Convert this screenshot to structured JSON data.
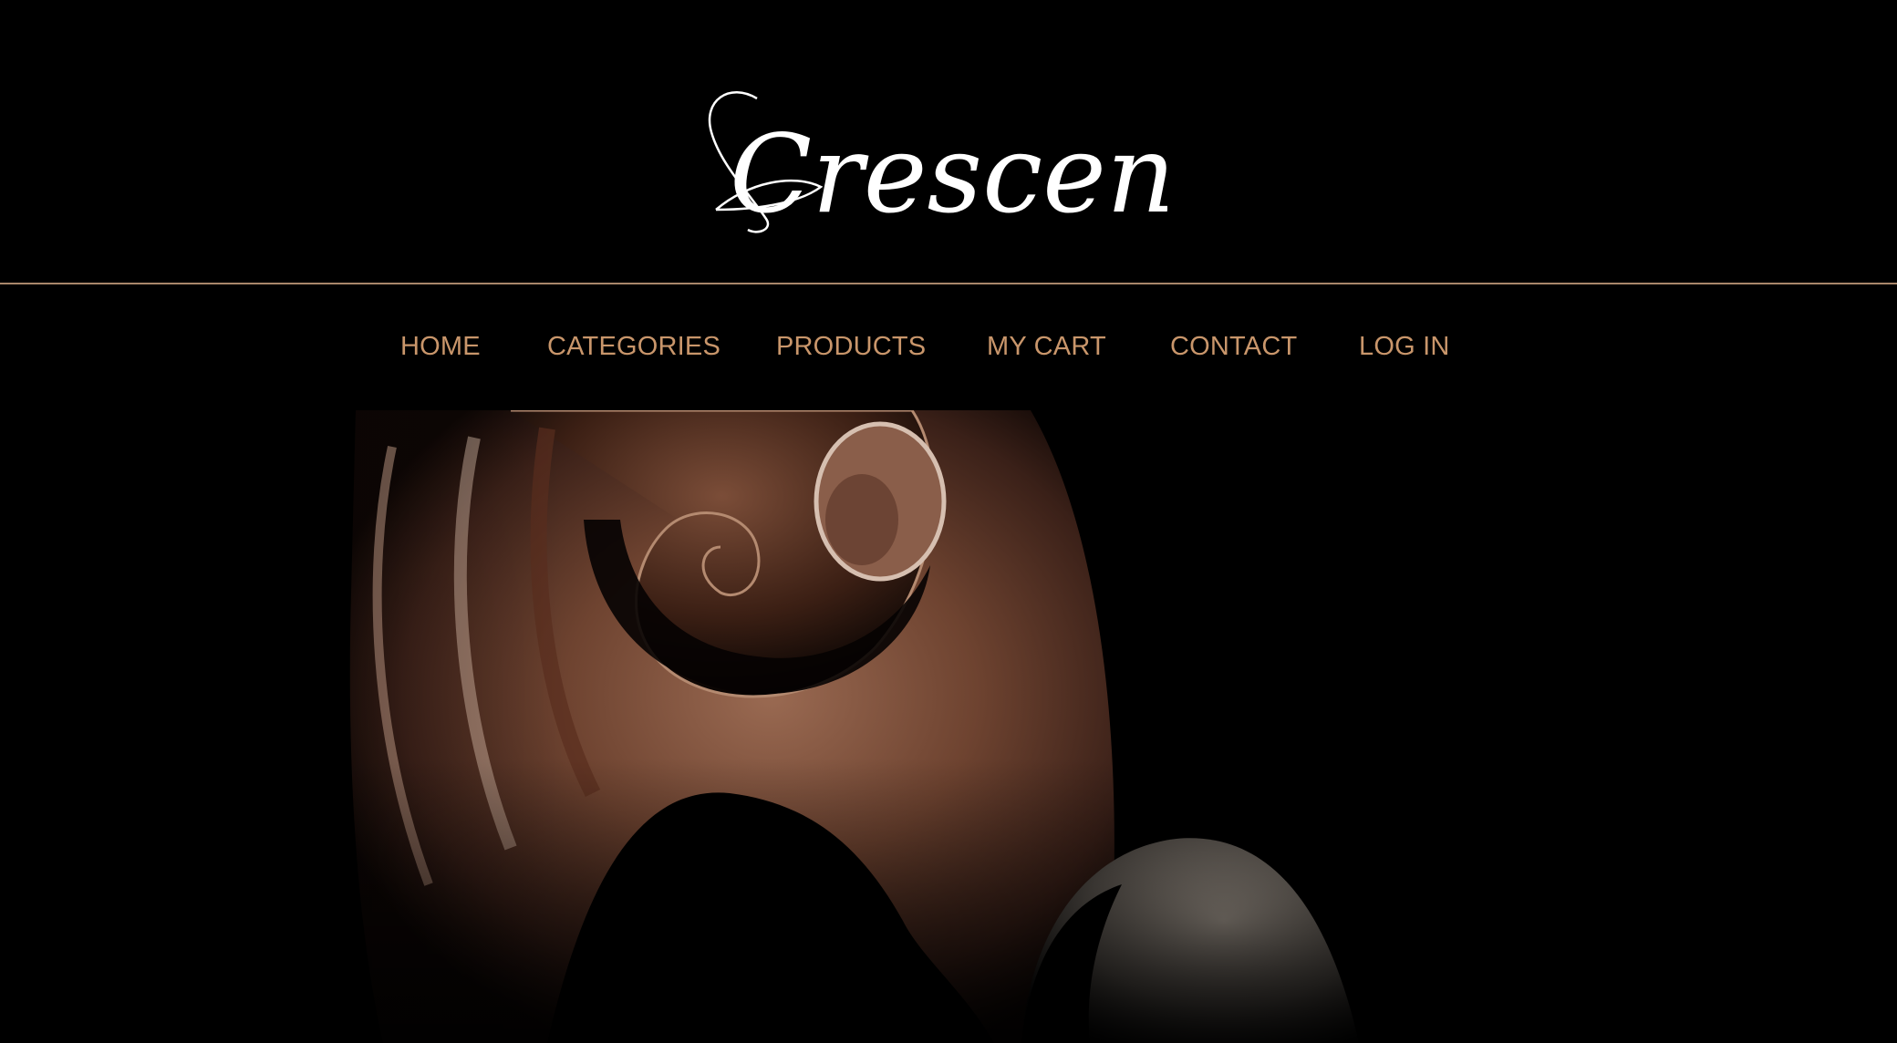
{
  "brand": {
    "name": "Crescendo",
    "logo_color": "#ffffff"
  },
  "colors": {
    "background": "#000000",
    "nav_text": "#c9966b",
    "divider": "#a9866a",
    "wood": "#7a4a33"
  },
  "nav": {
    "items": [
      {
        "label": "HOME"
      },
      {
        "label": "CATEGORIES"
      },
      {
        "label": "PRODUCTS"
      },
      {
        "label": "MY CART"
      },
      {
        "label": "CONTACT"
      },
      {
        "label": "LOG IN"
      }
    ]
  },
  "hero": {
    "image": "violin-scroll-photo"
  }
}
